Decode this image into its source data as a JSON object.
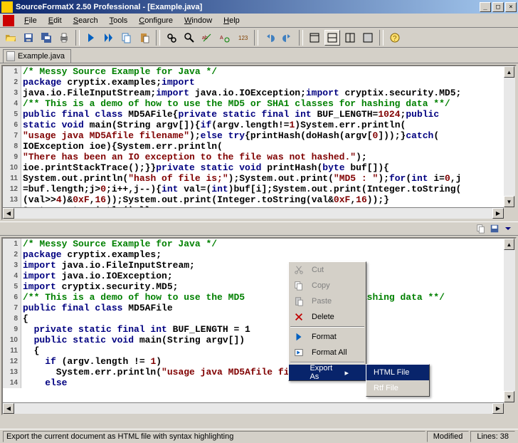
{
  "window": {
    "title": "SourceFormatX 2.50 Professional - [Example.java]"
  },
  "menubar": [
    "File",
    "Edit",
    "Search",
    "Tools",
    "Configure",
    "Window",
    "Help"
  ],
  "tab": {
    "label": "Example.java"
  },
  "code_top": [
    [
      [
        "c-comment",
        "/* Messy Source Example for Java */"
      ]
    ],
    [
      [
        "c-keyword",
        "package"
      ],
      [
        "c-plain",
        " cryptix.examples;"
      ],
      [
        "c-keyword",
        "import"
      ]
    ],
    [
      [
        "c-plain",
        "java.io.FileInputStream;"
      ],
      [
        "c-keyword",
        "import"
      ],
      [
        "c-plain",
        " java.io.IOException;"
      ],
      [
        "c-keyword",
        "import"
      ],
      [
        "c-plain",
        " cryptix.security.MD5;"
      ]
    ],
    [
      [
        "c-comment",
        "/** This is a demo of how to use the MD5 or SHA1 classes for hashing data **/"
      ]
    ],
    [
      [
        "c-keyword",
        "public final class"
      ],
      [
        "c-plain",
        " MD5AFile{"
      ],
      [
        "c-keyword",
        "private static final int"
      ],
      [
        "c-plain",
        " BUF_LENGTH="
      ],
      [
        "c-number",
        "1024"
      ],
      [
        "c-plain",
        ";"
      ],
      [
        "c-keyword",
        "public"
      ]
    ],
    [
      [
        "c-keyword",
        "static void"
      ],
      [
        "c-plain",
        " main(String argv[]){"
      ],
      [
        "c-keyword",
        "if"
      ],
      [
        "c-plain",
        "(argv.length!="
      ],
      [
        "c-number",
        "1"
      ],
      [
        "c-plain",
        ")System.err.println("
      ]
    ],
    [
      [
        "c-string",
        "\"usage java MD5Afile filename\""
      ],
      [
        "c-plain",
        ");"
      ],
      [
        "c-keyword",
        "else try"
      ],
      [
        "c-plain",
        "{printHash(doHash(argv["
      ],
      [
        "c-number",
        "0"
      ],
      [
        "c-plain",
        "]));}"
      ],
      [
        "c-keyword",
        "catch"
      ],
      [
        "c-plain",
        "("
      ]
    ],
    [
      [
        "c-plain",
        "IOException ioe){System.err.println("
      ]
    ],
    [
      [
        "c-string",
        "\"There has been an IO exception to the file was not hashed.\""
      ],
      [
        "c-plain",
        ");"
      ]
    ],
    [
      [
        "c-plain",
        "ioe.printStackTrace();}}"
      ],
      [
        "c-keyword",
        "private static void"
      ],
      [
        "c-plain",
        " printHash("
      ],
      [
        "c-keyword",
        "byte"
      ],
      [
        "c-plain",
        " buf[]){"
      ]
    ],
    [
      [
        "c-plain",
        "System.out.println("
      ],
      [
        "c-string",
        "\"hash of file is;\""
      ],
      [
        "c-plain",
        ");System.out.print("
      ],
      [
        "c-string",
        "\"MD5 : \""
      ],
      [
        "c-plain",
        ");"
      ],
      [
        "c-keyword",
        "for"
      ],
      [
        "c-plain",
        "("
      ],
      [
        "c-keyword",
        "int"
      ],
      [
        "c-plain",
        " i="
      ],
      [
        "c-number",
        "0"
      ],
      [
        "c-plain",
        ",j"
      ]
    ],
    [
      [
        "c-plain",
        "=buf.length;j>"
      ],
      [
        "c-number",
        "0"
      ],
      [
        "c-plain",
        ";i++,j--){"
      ],
      [
        "c-keyword",
        "int"
      ],
      [
        "c-plain",
        " val=("
      ],
      [
        "c-keyword",
        "int"
      ],
      [
        "c-plain",
        ")buf[i];System.out.print(Integer.toString("
      ]
    ],
    [
      [
        "c-plain",
        "(val>>"
      ],
      [
        "c-number",
        "4"
      ],
      [
        "c-plain",
        ")&"
      ],
      [
        "c-number",
        "0xF"
      ],
      [
        "c-plain",
        ","
      ],
      [
        "c-number",
        "16"
      ],
      [
        "c-plain",
        "));System.out.print(Integer.toString(val&"
      ],
      [
        "c-number",
        "0xF"
      ],
      [
        "c-plain",
        ","
      ],
      [
        "c-number",
        "16"
      ],
      [
        "c-plain",
        "));}"
      ]
    ],
    [
      [
        "c-plain",
        "Sustem.out.println():}}"
      ]
    ]
  ],
  "code_bottom": [
    [
      [
        "c-comment",
        "/* Messy Source Example for Java */"
      ]
    ],
    [
      [
        "c-keyword",
        "package"
      ],
      [
        "c-plain",
        " cryptix.examples;"
      ]
    ],
    [
      [
        "c-keyword",
        "import"
      ],
      [
        "c-plain",
        " java.io.FileInputStream;"
      ]
    ],
    [
      [
        "c-keyword",
        "import"
      ],
      [
        "c-plain",
        " java.io.IOException;"
      ]
    ],
    [
      [
        "c-keyword",
        "import"
      ],
      [
        "c-plain",
        " cryptix.security.MD5;"
      ]
    ],
    [
      [
        "c-comment",
        "/** This is a demo of how to use the MD5 "
      ],
      [
        "c-comment",
        "              "
      ],
      [
        "c-comment",
        " for hashing data **/"
      ]
    ],
    [
      [
        "c-keyword",
        "public final class"
      ],
      [
        "c-plain",
        " MD5AFile"
      ]
    ],
    [
      [
        "c-plain",
        "{"
      ]
    ],
    [
      [
        "c-plain",
        "  "
      ],
      [
        "c-keyword",
        "private static final int"
      ],
      [
        "c-plain",
        " BUF_LENGTH = 1"
      ]
    ],
    [
      [
        "c-plain",
        "  "
      ],
      [
        "c-keyword",
        "public static void"
      ],
      [
        "c-plain",
        " main(String argv[])"
      ]
    ],
    [
      [
        "c-plain",
        "  {"
      ]
    ],
    [
      [
        "c-plain",
        "    "
      ],
      [
        "c-keyword",
        "if"
      ],
      [
        "c-plain",
        " (argv.length != "
      ],
      [
        "c-number",
        "1"
      ],
      [
        "c-plain",
        ")"
      ]
    ],
    [
      [
        "c-plain",
        "      System.err.println("
      ],
      [
        "c-string",
        "\"usage java MD5Afile filename\""
      ],
      [
        "c-plain",
        ");"
      ]
    ],
    [
      [
        "c-plain",
        "    "
      ],
      [
        "c-keyword",
        "else"
      ]
    ]
  ],
  "context_menu": {
    "items": [
      {
        "icon": "cut",
        "label": "Cut",
        "disabled": true
      },
      {
        "icon": "copy",
        "label": "Copy",
        "disabled": true
      },
      {
        "icon": "paste",
        "label": "Paste",
        "disabled": true
      },
      {
        "icon": "delete",
        "label": "Delete",
        "disabled": false
      },
      {
        "sep": true
      },
      {
        "icon": "format",
        "label": "Format",
        "disabled": false
      },
      {
        "icon": "format-all",
        "label": "Format All",
        "disabled": false
      },
      {
        "sep": true
      },
      {
        "icon": "",
        "label": "Export As",
        "disabled": false,
        "highlight": true,
        "submenu": true
      }
    ],
    "submenu": [
      {
        "label": "HTML File",
        "highlight": true
      },
      {
        "label": "Rtf File",
        "highlight": false
      }
    ]
  },
  "statusbar": {
    "hint": "Export the current document as HTML file with syntax highlighting",
    "modified": "Modified",
    "lines": "Lines: 38"
  }
}
